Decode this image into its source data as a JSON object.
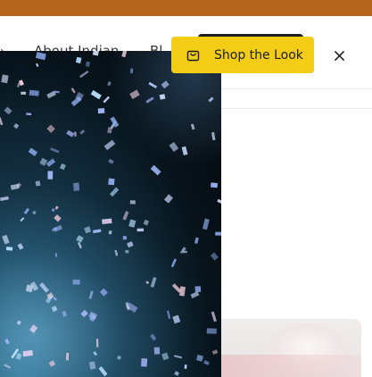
{
  "header": {
    "nav": {
      "about_label": "About Indian",
      "blog_label": "Bl"
    }
  },
  "overlay": {
    "shop_button_label": "Shop the Look",
    "close_icon": "close-icon",
    "bag_icon": "shopping-bag-icon"
  },
  "colors": {
    "announcement": "#b5651d",
    "shop_button": "#f2cc15",
    "hero_dark": "#07121a"
  }
}
